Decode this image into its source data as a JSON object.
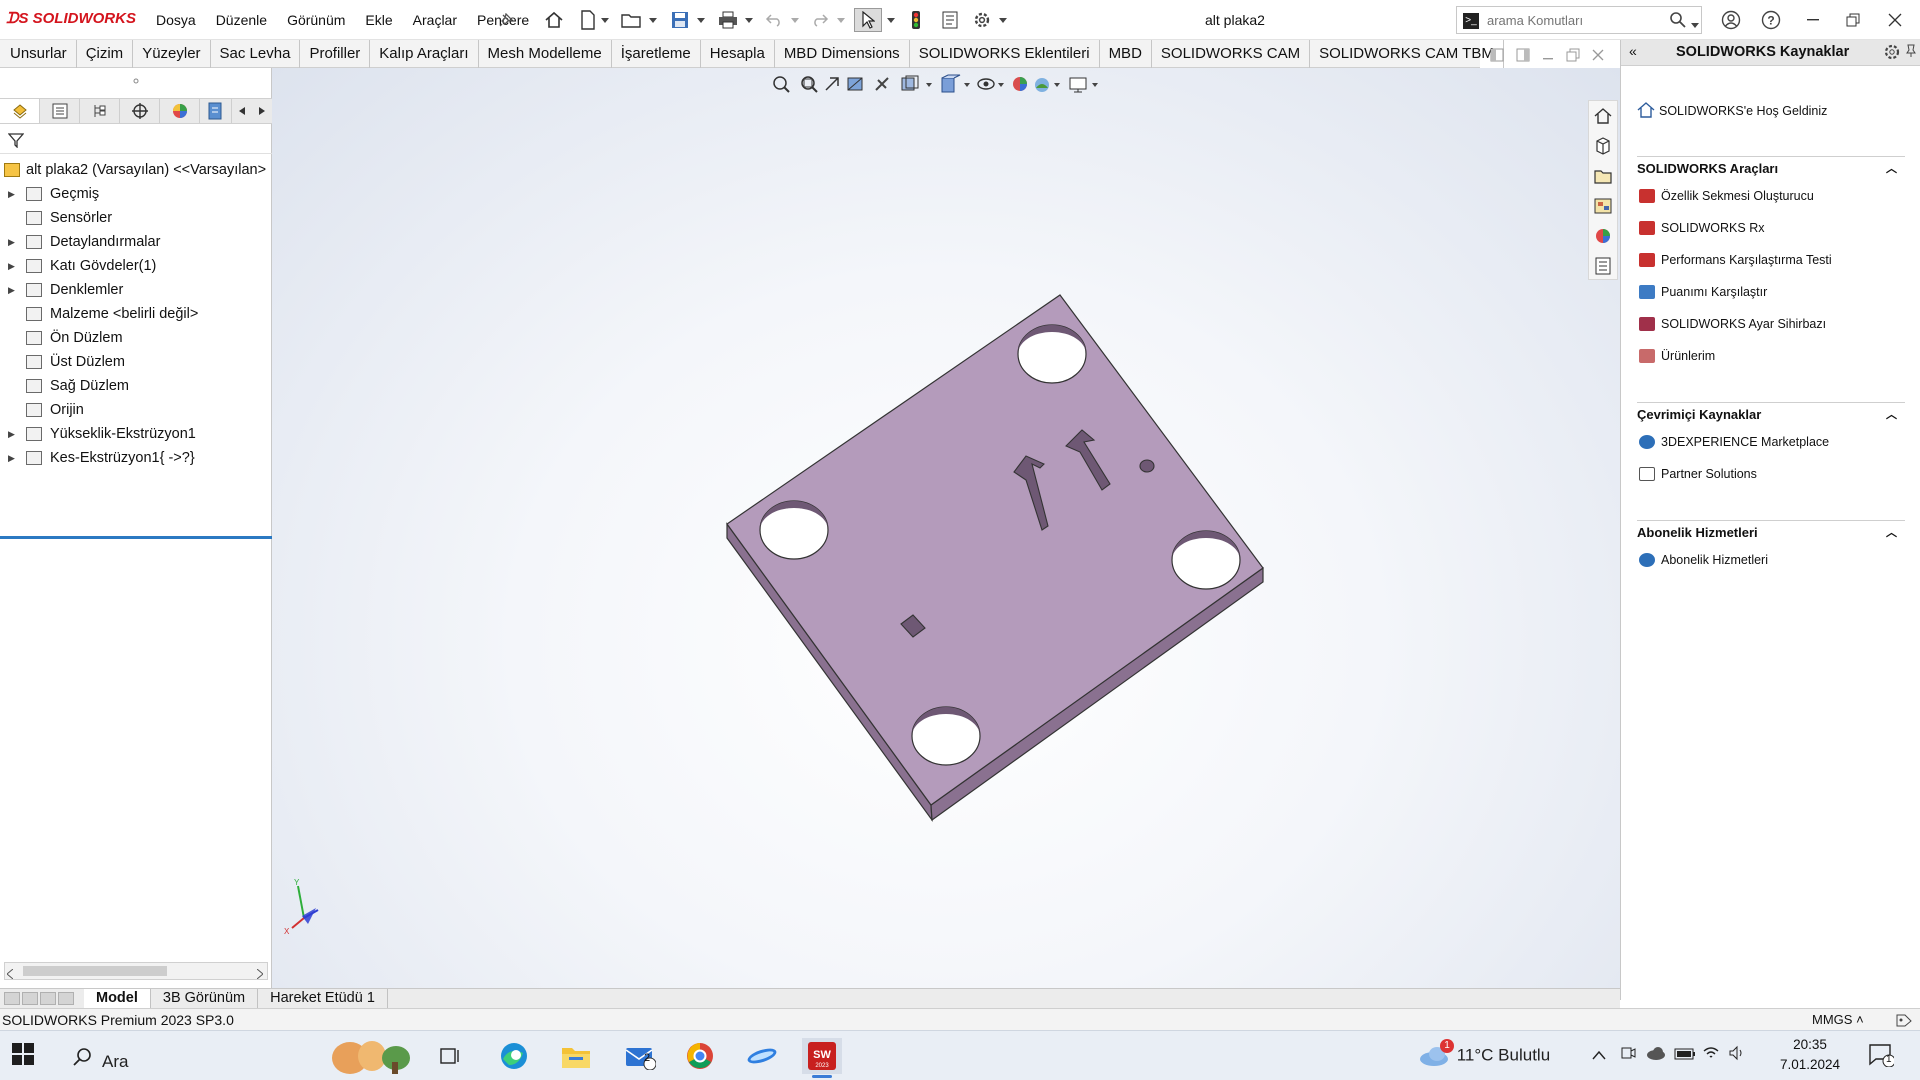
{
  "app": {
    "logo_text": "SOLIDWORKS",
    "doc_title": "alt plaka2",
    "menus": [
      "Dosya",
      "Düzenle",
      "Görünüm",
      "Ekle",
      "Araçlar",
      "Pencere"
    ]
  },
  "search": {
    "placeholder": "arama Komutları"
  },
  "command_tabs": [
    "Unsurlar",
    "Çizim",
    "Yüzeyler",
    "Sac Levha",
    "Profiller",
    "Kalıp Araçları",
    "Mesh Modelleme",
    "İşaretleme",
    "Hesapla",
    "MBD Dimensions",
    "SOLIDWORKS Eklentileri",
    "MBD",
    "SOLIDWORKS CAM",
    "SOLIDWORKS CAM TBM"
  ],
  "tree": {
    "root": "alt plaka2 (Varsayılan) <<Varsayılan>",
    "items": [
      {
        "label": "Geçmiş",
        "expandable": true
      },
      {
        "label": "Sensörler",
        "expandable": false
      },
      {
        "label": "Detaylandırmalar",
        "expandable": true
      },
      {
        "label": "Katı Gövdeler(1)",
        "expandable": true
      },
      {
        "label": "Denklemler",
        "expandable": true
      },
      {
        "label": "Malzeme <belirli değil>",
        "expandable": false
      },
      {
        "label": "Ön Düzlem",
        "expandable": false
      },
      {
        "label": "Üst Düzlem",
        "expandable": false
      },
      {
        "label": "Sağ Düzlem",
        "expandable": false
      },
      {
        "label": "Orijin",
        "expandable": false
      },
      {
        "label": "Yükseklik-Ekstrüzyon1",
        "expandable": true
      },
      {
        "label": "Kes-Ekstrüzyon1{ ->?}",
        "expandable": true
      }
    ]
  },
  "triad": {
    "y_label": "Y",
    "x_label": "X"
  },
  "resources": {
    "title": "SOLIDWORKS Kaynaklar",
    "welcome": "SOLIDWORKS'e Hoş Geldiniz",
    "sections": [
      {
        "title": "SOLIDWORKS Araçları",
        "items": [
          "Özellik Sekmesi Oluşturucu",
          "SOLIDWORKS Rx",
          "Performans Karşılaştırma Testi",
          "Puanımı Karşılaştır",
          "SOLIDWORKS Ayar Sihirbazı",
          "Ürünlerim"
        ]
      },
      {
        "title": "Çevrimiçi Kaynaklar",
        "items": [
          "3DEXPERIENCE Marketplace",
          "Partner Solutions"
        ]
      },
      {
        "title": "Abonelik Hizmetleri",
        "items": [
          "Abonelik Hizmetleri"
        ]
      }
    ]
  },
  "bottom_tabs": [
    "Model",
    "3B Görünüm",
    "Hareket Etüdü 1"
  ],
  "status": {
    "version": "SOLIDWORKS Premium 2023 SP3.0",
    "units": "MMGS"
  },
  "taskbar": {
    "search_label": "Ara",
    "mail_badge": "2",
    "weather_badge": "1",
    "weather": "11°C  Bulutlu",
    "time": "20:35",
    "date": "7.01.2024",
    "notification_count": "1"
  },
  "colors": {
    "part_face": "#b49bbb",
    "part_side": "#8a7190",
    "accent": "#2b79c2",
    "brand": "#d4141d"
  }
}
